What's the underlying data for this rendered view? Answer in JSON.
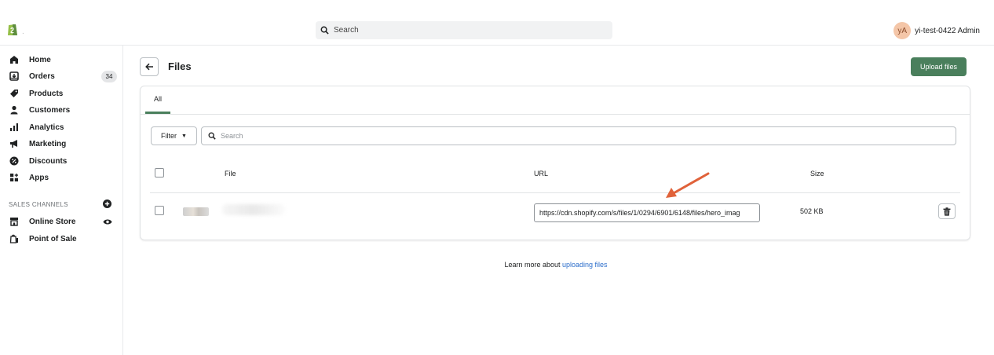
{
  "topbar": {
    "search_placeholder": "Search",
    "avatar_initials": "yA",
    "user_name": "yi-test-0422 Admin"
  },
  "sidebar": {
    "items": [
      {
        "label": "Home",
        "icon": "home-icon"
      },
      {
        "label": "Orders",
        "icon": "orders-icon",
        "badge": "34"
      },
      {
        "label": "Products",
        "icon": "tag-icon"
      },
      {
        "label": "Customers",
        "icon": "person-icon"
      },
      {
        "label": "Analytics",
        "icon": "bar-chart-icon"
      },
      {
        "label": "Marketing",
        "icon": "megaphone-icon"
      },
      {
        "label": "Discounts",
        "icon": "discount-icon"
      },
      {
        "label": "Apps",
        "icon": "apps-icon"
      }
    ],
    "sales_channels_heading": "SALES CHANNELS",
    "channels": [
      {
        "label": "Online Store",
        "icon": "store-icon"
      },
      {
        "label": "Point of Sale",
        "icon": "pos-bag-icon"
      }
    ]
  },
  "header": {
    "title": "Files",
    "upload_label": "Upload files"
  },
  "tabs": [
    {
      "label": "All",
      "selected": true
    }
  ],
  "toolbar": {
    "filter_label": "Filter",
    "search_placeholder": "Search"
  },
  "table": {
    "columns": {
      "file": "File",
      "url": "URL",
      "size": "Size"
    },
    "rows": [
      {
        "url": "https://cdn.shopify.com/s/files/1/0294/6901/6148/files/hero_imag",
        "size": "502 KB"
      }
    ]
  },
  "footer": {
    "learn_prefix": "Learn more about ",
    "learn_link": "uploading files"
  },
  "colors": {
    "primary": "#4a7f5c",
    "link": "#2c6ecb",
    "annotation_arrow": "#e0623a"
  }
}
